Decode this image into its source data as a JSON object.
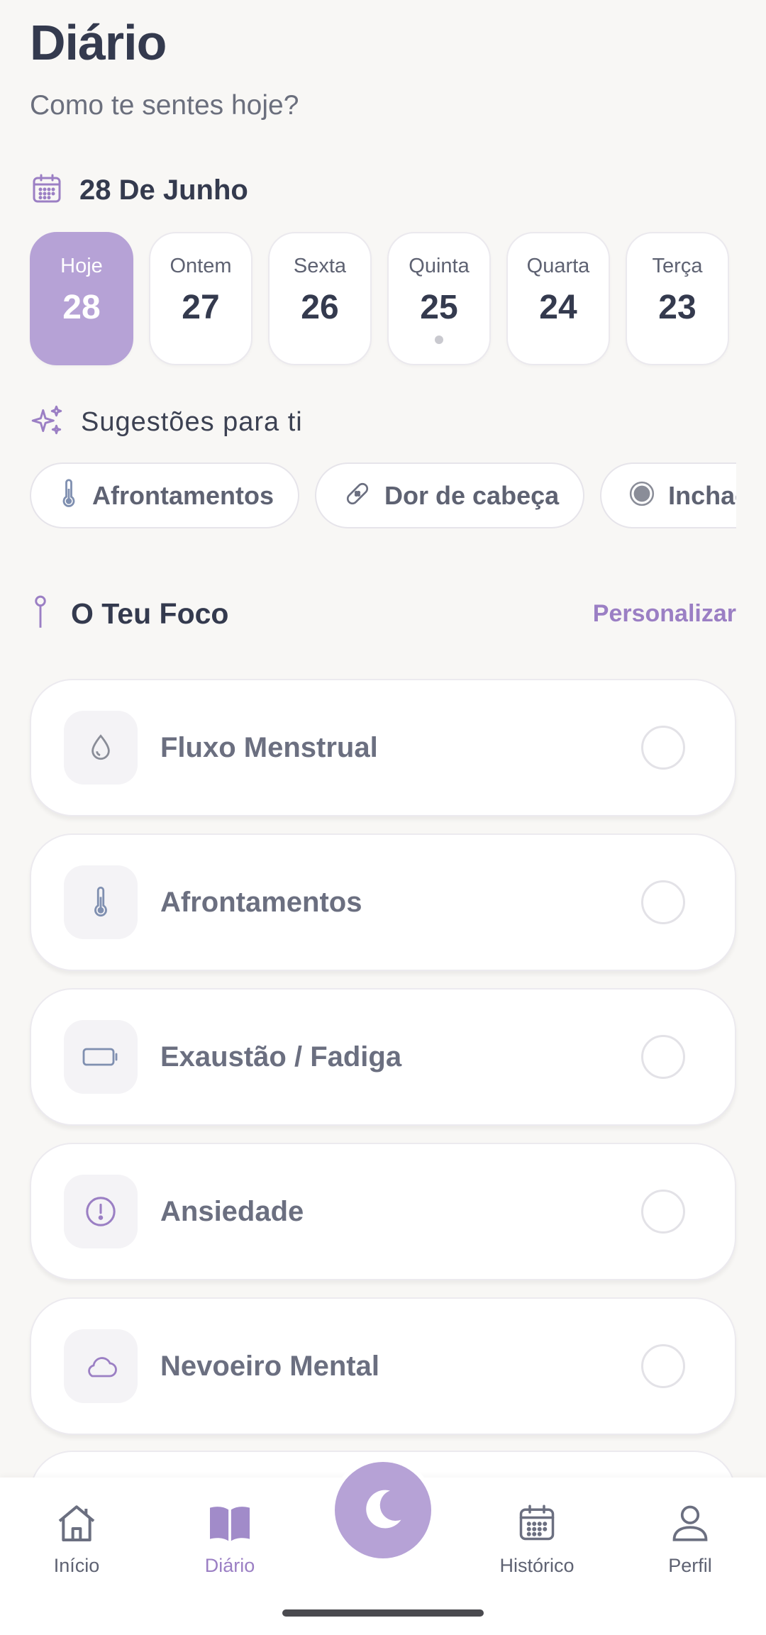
{
  "header": {
    "title": "Diário",
    "subtitle": "Como te sentes hoje?"
  },
  "date": {
    "label": "28 De Junho"
  },
  "days": [
    {
      "name": "Hoje",
      "num": "28",
      "active": true
    },
    {
      "name": "Ontem",
      "num": "27"
    },
    {
      "name": "Sexta",
      "num": "26"
    },
    {
      "name": "Quinta",
      "num": "25",
      "has_entry_dot": true
    },
    {
      "name": "Quarta",
      "num": "24"
    },
    {
      "name": "Terça",
      "num": "23"
    }
  ],
  "suggestions": {
    "title": "Sugestões para ti",
    "chips": [
      {
        "label": "Afrontamentos",
        "icon": "thermometer-icon"
      },
      {
        "label": "Dor de cabeça",
        "icon": "bandage-icon"
      },
      {
        "label": "Inchaço A",
        "icon": "circle-dot-icon"
      }
    ]
  },
  "focus": {
    "title": "O Teu Foco",
    "customize_label": "Personalizar",
    "items": [
      {
        "label": "Fluxo Menstrual",
        "icon": "droplet-icon"
      },
      {
        "label": "Afrontamentos",
        "icon": "thermometer-icon"
      },
      {
        "label": "Exaustão / Fadiga",
        "icon": "battery-icon"
      },
      {
        "label": "Ansiedade",
        "icon": "alert-circle-icon"
      },
      {
        "label": "Nevoeiro Mental",
        "icon": "cloud-icon"
      }
    ]
  },
  "nav": {
    "home": "Início",
    "diary": "Diário",
    "history": "Histórico",
    "profile": "Perfil",
    "active": "diary"
  },
  "colors": {
    "accent": "#b6a2d6",
    "accent_text": "#9b7fc4",
    "background": "#f8f7f5",
    "text_primary": "#343a4e"
  }
}
